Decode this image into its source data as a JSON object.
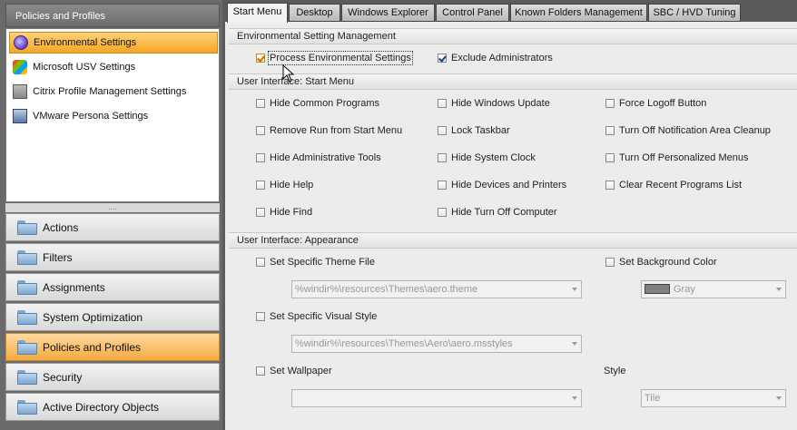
{
  "left": {
    "header": "Policies and Profiles",
    "tree": [
      {
        "label": "Environmental Settings",
        "icon": "environment-icon",
        "selected": true
      },
      {
        "label": "Microsoft USV Settings",
        "icon": "windows-icon",
        "selected": false
      },
      {
        "label": "Citrix Profile Management Settings",
        "icon": "citrix-icon",
        "selected": false
      },
      {
        "label": "VMware Persona Settings",
        "icon": "vmware-icon",
        "selected": false
      }
    ],
    "grip": "....",
    "nav": [
      {
        "label": "Actions"
      },
      {
        "label": "Filters"
      },
      {
        "label": "Assignments"
      },
      {
        "label": "System Optimization"
      },
      {
        "label": "Policies and Profiles",
        "selected": true
      },
      {
        "label": "Security"
      },
      {
        "label": "Active Directory Objects"
      }
    ]
  },
  "tabs": [
    "Start Menu",
    "Desktop",
    "Windows Explorer",
    "Control Panel",
    "Known Folders Management",
    "SBC / HVD Tuning"
  ],
  "selected_tab": "Start Menu",
  "env_section": {
    "title": "Environmental Setting Management",
    "process_label": "Process Environmental Settings",
    "process_checked": true,
    "exclude_label": "Exclude Administrators",
    "exclude_checked": true
  },
  "start_menu_section": {
    "title": "User Interface: Start Menu",
    "col1": [
      "Hide Common Programs",
      "Remove Run from Start Menu",
      "Hide Administrative Tools",
      "Hide Help",
      "Hide Find"
    ],
    "col2": [
      "Hide Windows Update",
      "Lock Taskbar",
      "Hide System Clock",
      "Hide Devices and Printers",
      "Hide Turn Off Computer"
    ],
    "col3": [
      "Force Logoff Button",
      "Turn Off Notification Area Cleanup",
      "Turn Off Personalized Menus",
      "Clear Recent Programs List"
    ]
  },
  "appearance_section": {
    "title": "User Interface: Appearance",
    "theme_label": "Set Specific Theme File",
    "theme_value": "%windir%\\resources\\Themes\\aero.theme",
    "bgcolor_label": "Set Background Color",
    "bgcolor_value": "Gray",
    "bgcolor_swatch": "#808080",
    "visual_label": "Set Specific Visual Style",
    "visual_value": "%windir%\\resources\\Themes\\Aero\\aero.msstyles",
    "wallpaper_label": "Set Wallpaper",
    "wallpaper_value": "",
    "style_label": "Style",
    "style_value": "Tile"
  },
  "colors": {
    "accent": "#f5a623",
    "chrome": "#5b5b5b"
  }
}
